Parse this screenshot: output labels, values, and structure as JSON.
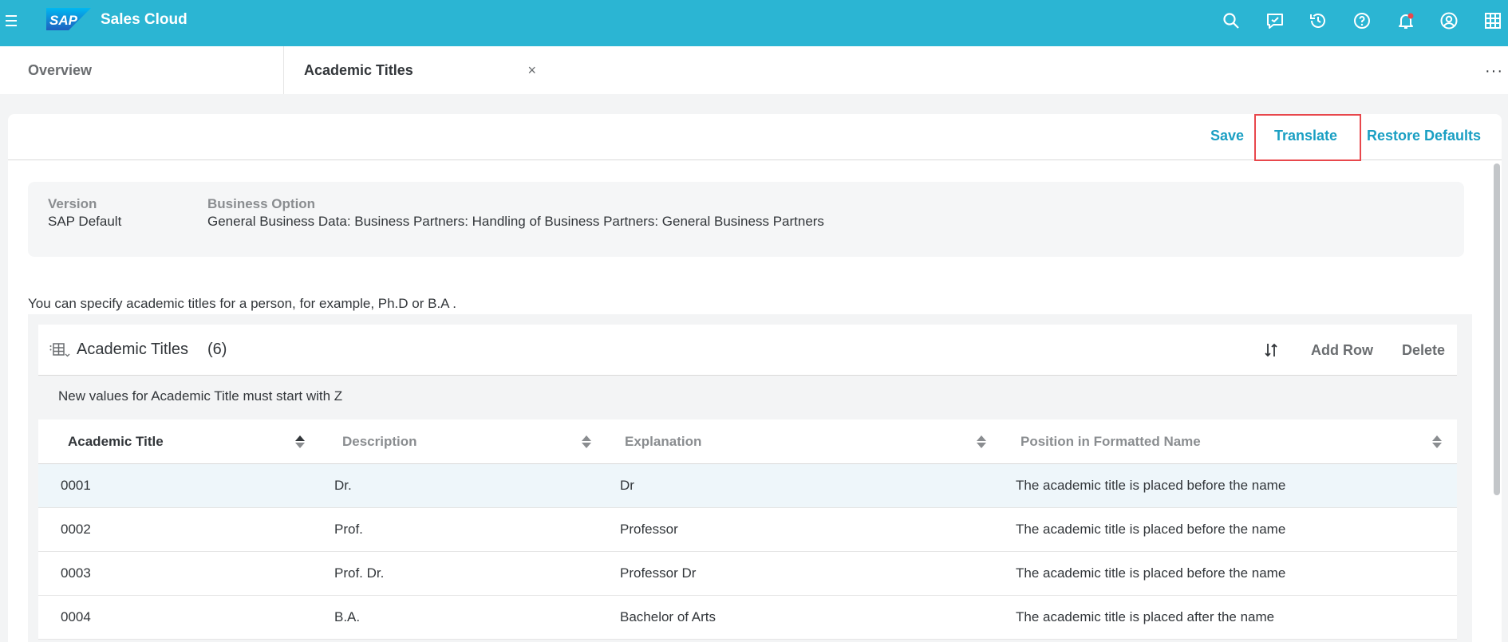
{
  "shell": {
    "logo_text": "SAP",
    "app_title": "Sales Cloud",
    "icons": [
      "search-icon",
      "feedback-icon",
      "history-icon",
      "help-icon",
      "notification-icon",
      "user-icon",
      "grid-icon"
    ]
  },
  "tabs": [
    {
      "label": "Overview"
    },
    {
      "label": "Academic Titles",
      "close": "×"
    }
  ],
  "tab_overflow": "···",
  "actions": {
    "save": "Save",
    "translate": "Translate",
    "restore": "Restore Defaults"
  },
  "info": {
    "version_label": "Version",
    "version_value": "SAP Default",
    "option_label": "Business Option",
    "option_value": "General Business Data: Business Partners: Handling of Business Partners: General Business Partners"
  },
  "hint": "You can specify academic titles for a person, for example, Ph.D or B.A .",
  "table": {
    "title": "Academic Titles",
    "count": "(6)",
    "add_row": "Add Row",
    "delete": "Delete",
    "info_text": "New values for Academic Title must start with Z",
    "columns": [
      "Academic Title",
      "Description",
      "Explanation",
      "Position in Formatted Name"
    ],
    "rows": [
      {
        "code": "0001",
        "description": "Dr.",
        "explanation": "Dr",
        "position": "The academic title is placed before the name"
      },
      {
        "code": "0002",
        "description": "Prof.",
        "explanation": "Professor",
        "position": "The academic title is placed before the name"
      },
      {
        "code": "0003",
        "description": "Prof. Dr.",
        "explanation": "Professor Dr",
        "position": "The academic title is placed before the name"
      },
      {
        "code": "0004",
        "description": "B.A.",
        "explanation": "Bachelor of Arts",
        "position": "The academic title is placed after the name"
      }
    ]
  },
  "colors": {
    "shell": "#2bb5d3",
    "action": "#1a9fc3",
    "highlight": "#e8474c"
  }
}
